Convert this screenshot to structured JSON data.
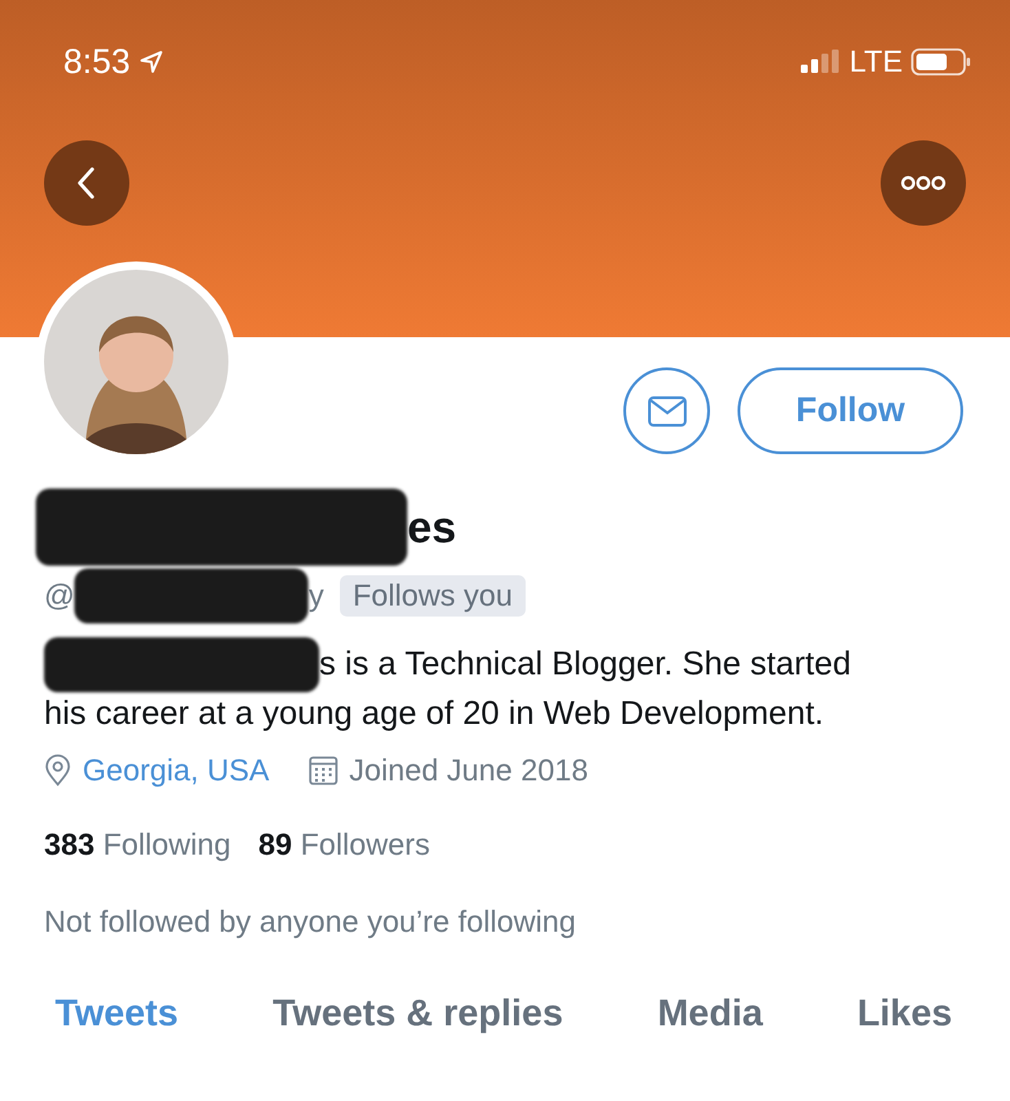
{
  "status_bar": {
    "time": "8:53",
    "network": "LTE"
  },
  "profile": {
    "name_visible": "es",
    "handle_start": "@",
    "handle_end": "y",
    "follows_you": "Follows you",
    "bio_lines": [
      "s is a Technical Blogger. She started",
      "his career at a young age of 20 in Web Development."
    ],
    "location": "Georgia, USA",
    "joined": "Joined June 2018",
    "following_count": "383",
    "following_label": "Following",
    "followers_count": "89",
    "followers_label": "Followers",
    "followed_by": "Not followed by anyone you’re following"
  },
  "follow_button": "Follow",
  "tabs": [
    {
      "label": "Tweets",
      "selected": true
    },
    {
      "label": "Tweets & replies",
      "selected": false
    },
    {
      "label": "Media",
      "selected": false
    },
    {
      "label": "Likes",
      "selected": false
    }
  ]
}
